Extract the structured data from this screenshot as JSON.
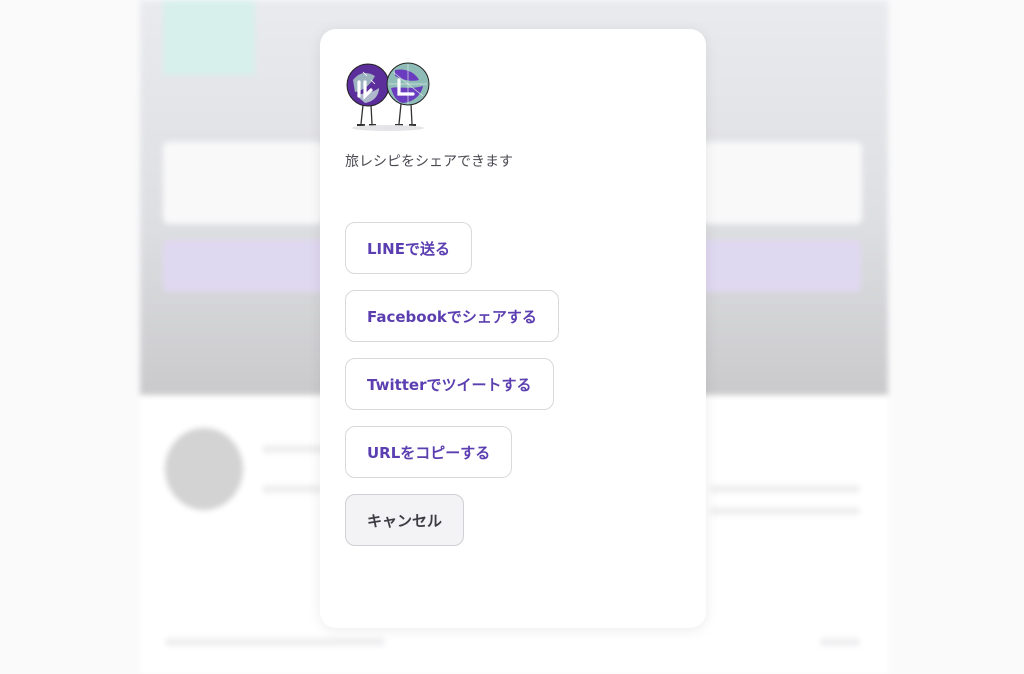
{
  "modal": {
    "subtitle": "旅レシピをシェアできます",
    "buttons": {
      "line": "LINEで送る",
      "facebook": "Facebookでシェアする",
      "twitter": "Twitterでツイートする",
      "copy_url": "URLをコピーする",
      "cancel": "キャンセル"
    }
  },
  "colors": {
    "accent": "#5b3fb0",
    "border": "#d9d9dd",
    "cancel_bg": "#f3f3f5"
  },
  "icons": {
    "logo": "two-globes-mascot-logo"
  }
}
